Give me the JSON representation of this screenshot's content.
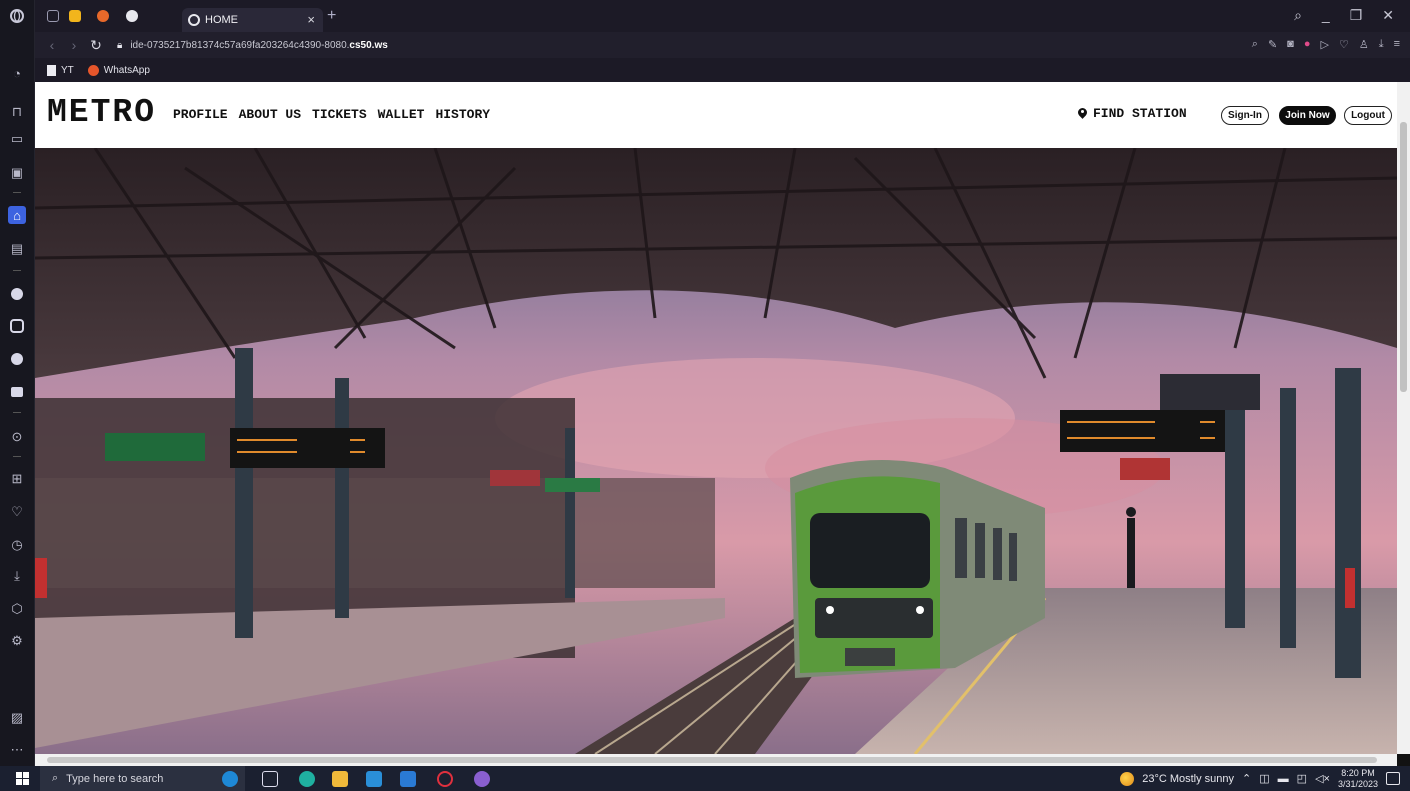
{
  "browser": {
    "active_tab_title": "HOME",
    "new_tab_symbol": "+",
    "url_prefix": "ide-0735217b81374c57a69fa203264c4390-8080.",
    "url_domain": "cs50.ws",
    "bookmarks": [
      {
        "label": "YT",
        "icon": "document-icon"
      },
      {
        "label": "WhatsApp",
        "icon": "whatsapp-icon"
      }
    ]
  },
  "site": {
    "logo": "METRO",
    "nav": [
      "PROFILE",
      "ABOUT US",
      "TICKETS",
      "WALLET",
      "HISTORY"
    ],
    "find_station": "FIND STATION",
    "buttons": {
      "signin": "Sign-In",
      "join": "Join Now",
      "logout": "Logout"
    }
  },
  "taskbar": {
    "search_placeholder": "Type here to search",
    "weather": "23°C  Mostly sunny",
    "time": "8:20 PM",
    "date": "3/31/2023"
  },
  "colors": {
    "browser_bg": "#1c1a26",
    "page_header_bg": "#ffffff",
    "join_button_bg": "#0c0c0c",
    "taskbar_bg": "#1b2030"
  }
}
